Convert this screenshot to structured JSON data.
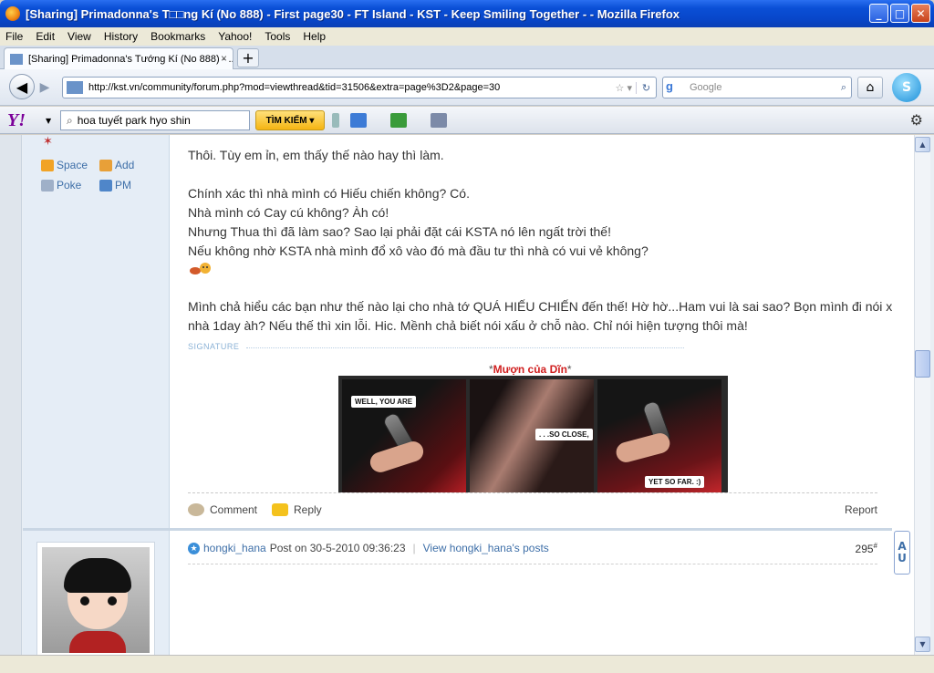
{
  "window": {
    "title": "[Sharing] Primadonna's T□□ng Kí (No 888) - First page30 - FT Island - KST - Keep Smiling Together - - Mozilla Firefox",
    "minimize": "_",
    "maximize": "□",
    "close": "✕"
  },
  "menu": [
    "File",
    "Edit",
    "View",
    "History",
    "Bookmarks",
    "Yahoo!",
    "Tools",
    "Help"
  ],
  "tab": {
    "label": "[Sharing] Primadonna's Tướng Kí (No 888) - ...",
    "close": "×",
    "new": "+"
  },
  "nav": {
    "url": "http://kst.vn/community/forum.php?mod=viewthread&tid=31506&extra=page%3D2&page=30",
    "search_placeholder": "Google"
  },
  "yahoo": {
    "logo": "Y!",
    "search_value": "hoa tuyết park hyo shin",
    "search_button": "TÌM KIẾM ▾"
  },
  "post1": {
    "side": {
      "space": "Space",
      "add": "Add",
      "poke": "Poke",
      "pm": "PM"
    },
    "lines": [
      "Thôi. Tùy em ỉn, em thấy thế nào hay thì làm.",
      "Chính xác thì nhà mình có Hiếu chiến không? Có.",
      "Nhà mình có Cay cú không? Àh có!",
      "Nhưng Thua thì đã làm sao? Sao lại phải đặt cái KSTA nó lên ngất trời thế!",
      "Nếu không nhờ KSTA nhà mình đổ xô vào đó mà đầu tư thì nhà có vui vẻ không?",
      "Mình chả hiểu các bạn như thế nào lại cho nhà tớ QUÁ HIẾU CHIẾN đến thế! Hờ hờ...Ham vui là sai sao? Bọn mình đi nói xấu",
      "nhà 1day àh? Nếu thế thì xin lỗi. Hic. Mềnh chả biết nói xấu ở chỗ nào. Chỉ nói hiện tượng thôi mà!"
    ],
    "signature_label": "SIGNATURE",
    "caption": "Mượn của Dĩn",
    "panels": [
      "WELL, YOU ARE",
      ". . .SO CLOSE,",
      "YET SO FAR. :)"
    ],
    "actions": {
      "comment": "Comment",
      "reply": "Reply",
      "report": "Report"
    }
  },
  "post2": {
    "author": "hongki_hana",
    "posted": "Post on 30-5-2010 09:36:23",
    "view_posts": "View hongki_hana's posts",
    "floor": "295",
    "floor_sup": "#"
  },
  "sidebutton": [
    "A",
    "U"
  ],
  "colors": {
    "link": "#3e6fa8",
    "caption": "#d02020",
    "titlebar": "#0a4fd6"
  }
}
